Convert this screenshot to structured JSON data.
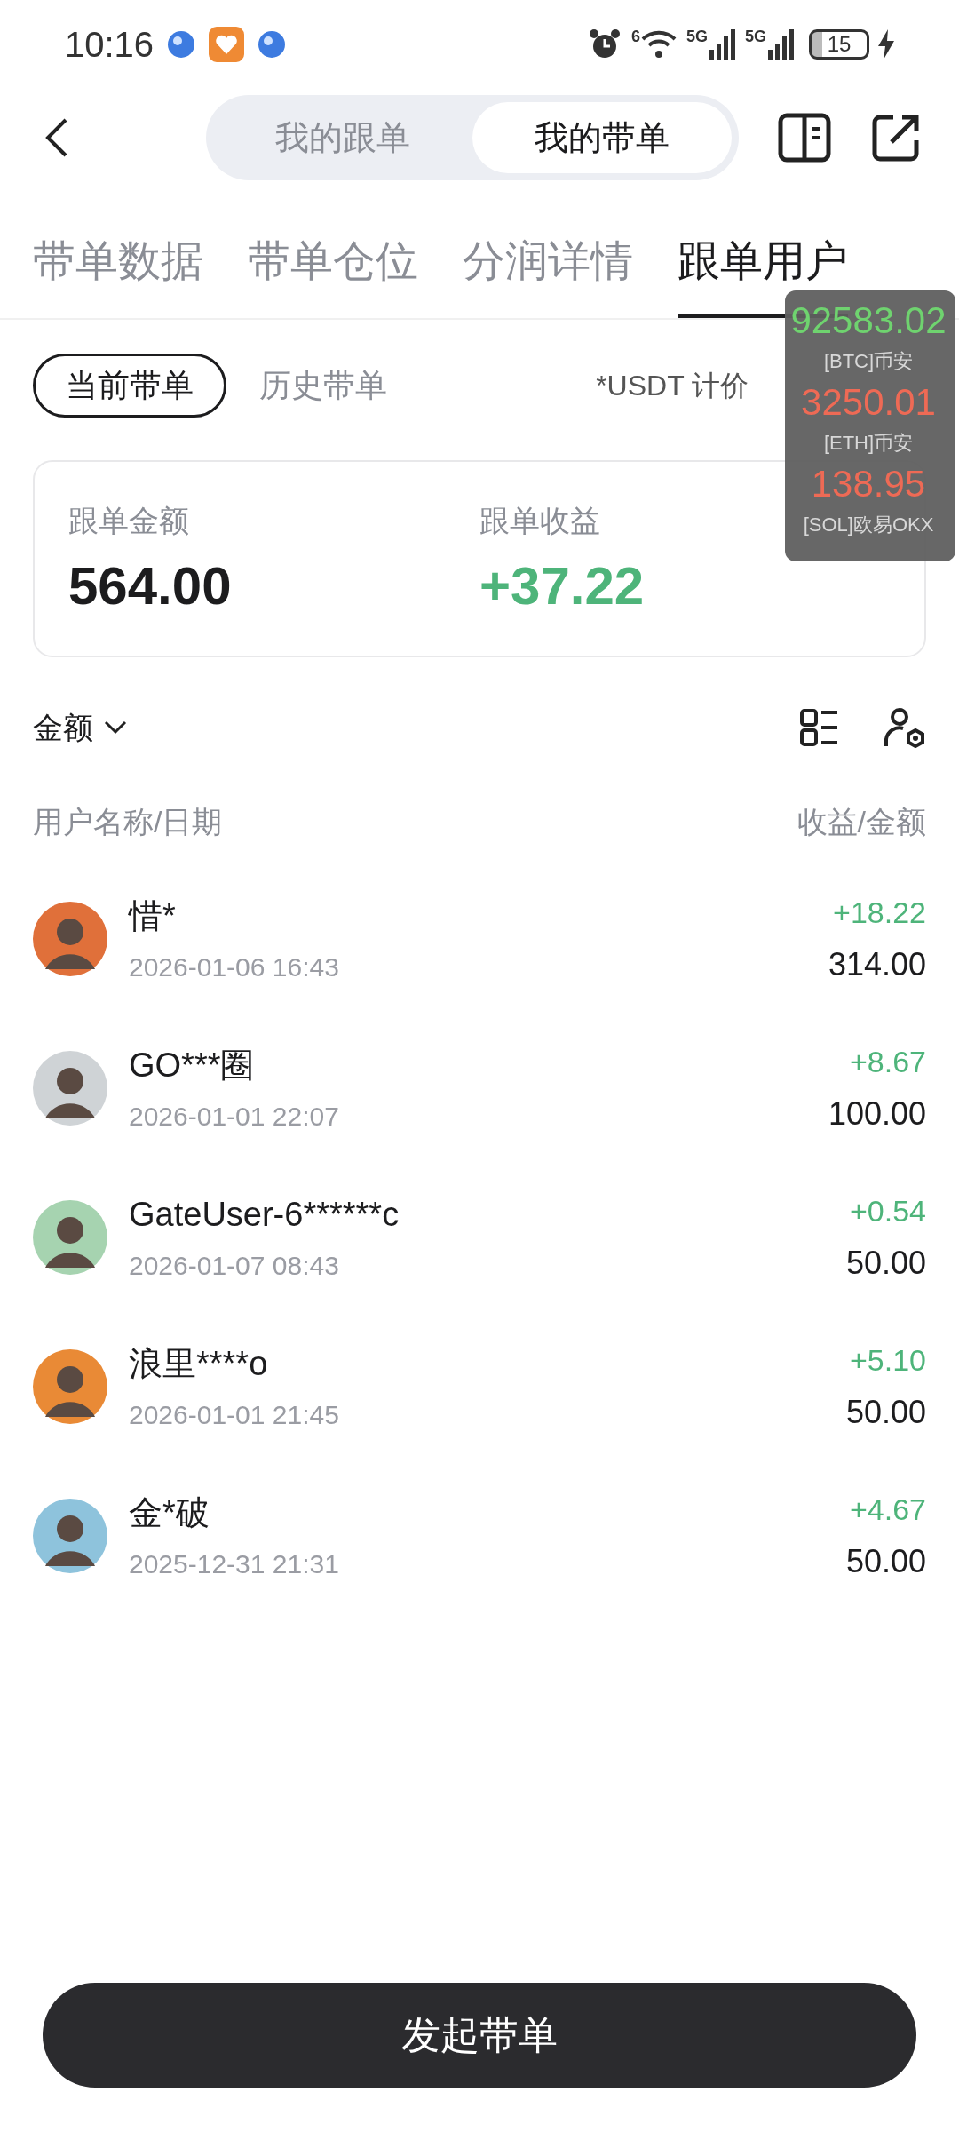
{
  "status_bar": {
    "time": "10:16",
    "wifi_label": "6",
    "network_labels": [
      "5G",
      "5G"
    ],
    "battery": "15",
    "charging": true
  },
  "header": {
    "segments": [
      {
        "label": "我的跟单",
        "selected": false
      },
      {
        "label": "我的带单",
        "selected": true
      }
    ]
  },
  "tabs": [
    {
      "label": "带单数据",
      "selected": false
    },
    {
      "label": "带单仓位",
      "selected": false
    },
    {
      "label": "分润详情",
      "selected": false
    },
    {
      "label": "跟单用户",
      "selected": true
    }
  ],
  "sub_tabs": [
    {
      "label": "当前带单",
      "selected": true
    },
    {
      "label": "历史带单",
      "selected": false
    }
  ],
  "unit_note": "*USDT 计价",
  "summary": [
    {
      "label": "跟单金额",
      "value": "564.00",
      "kind": "plain"
    },
    {
      "label": "跟单收益",
      "value": "+37.22",
      "kind": "profit"
    }
  ],
  "sort": {
    "label": "金额"
  },
  "columns": [
    "用户名称/日期",
    "收益/金额"
  ],
  "users": [
    {
      "name": "惜*",
      "date": "2026-01-06 16:43",
      "profit": "+18.22",
      "amount": "314.00",
      "color": "#e0703a"
    },
    {
      "name": "GO***圈",
      "date": "2026-01-01 22:07",
      "profit": "+8.67",
      "amount": "100.00",
      "color": "#cfd3d6"
    },
    {
      "name": "GateUser-6******c",
      "date": "2026-01-07 08:43",
      "profit": "+0.54",
      "amount": "50.00",
      "color": "#a6d3b0"
    },
    {
      "name": "浪里****o",
      "date": "2026-01-01 21:45",
      "profit": "+5.10",
      "amount": "50.00",
      "color": "#e98a36"
    },
    {
      "name": "金*破",
      "date": "2025-12-31 21:31",
      "profit": "+4.67",
      "amount": "50.00",
      "color": "#8ec3dc"
    }
  ],
  "price_widget": [
    {
      "price": "92583.02",
      "pair": "[BTC]币安",
      "color": "#6fd36f"
    },
    {
      "price": "3250.01",
      "pair": "[ETH]币安",
      "color": "#ee6a55"
    },
    {
      "price": "138.95",
      "pair": "[SOL]欧易OKX",
      "color": "#ee6a55"
    }
  ],
  "action_button": "发起带单"
}
